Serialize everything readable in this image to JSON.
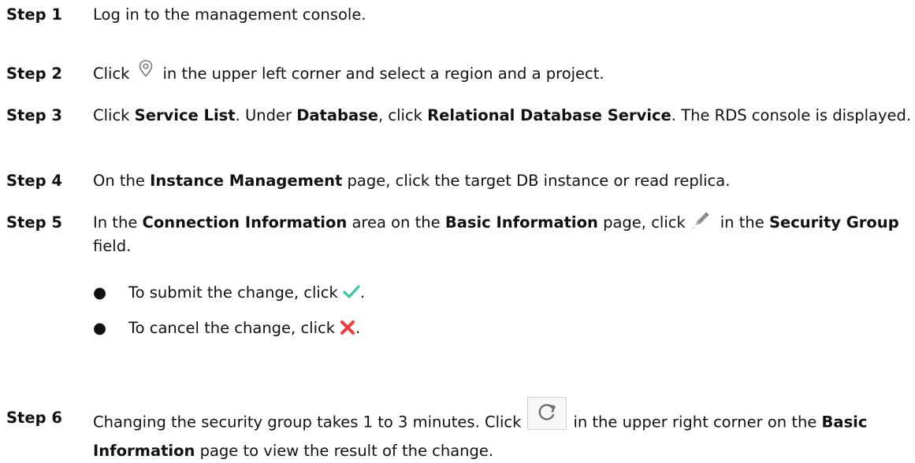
{
  "steps": [
    {
      "label": "Step 1",
      "text": "Log in to the management console."
    },
    {
      "label": "Step 2",
      "before_icon": "Click",
      "icon": "location-pin-icon",
      "after_icon": "in the upper left corner and select a region and a project."
    },
    {
      "label": "Step 3",
      "t1": "Click ",
      "b1": "Service List",
      "t2": ". Under ",
      "b2": "Database",
      "t3": ", click ",
      "b3": "Relational Database Service",
      "t4": ". The RDS console is displayed."
    },
    {
      "label": "Step 4",
      "t1": "On the ",
      "b1": "Instance Management",
      "t2": " page, click the target DB instance or read replica."
    },
    {
      "label": "Step 5",
      "t1": "In the ",
      "b1": "Connection Information",
      "t2": " area on the ",
      "b2": "Basic Information",
      "t3": " page, click",
      "icon": "pencil-edit-icon",
      "t4": "in the ",
      "b3": "Security Group",
      "t5": " field."
    },
    {
      "label": "Step 6",
      "t1": "Changing the security group takes 1 to 3 minutes. Click",
      "icon": "refresh-icon",
      "t2": "in the upper right corner on the ",
      "b1": "Basic Information",
      "t3": " page to view the result of the change."
    }
  ],
  "bullets": [
    {
      "marker": "●",
      "text": "To submit the change, click",
      "icon": "checkmark-icon",
      "end": ".",
      "icon_color": "#3cc5a5"
    },
    {
      "marker": "●",
      "text": "To cancel the change, click",
      "icon": "cross-icon",
      "end": ".",
      "icon_color": "#f23a3a"
    }
  ]
}
